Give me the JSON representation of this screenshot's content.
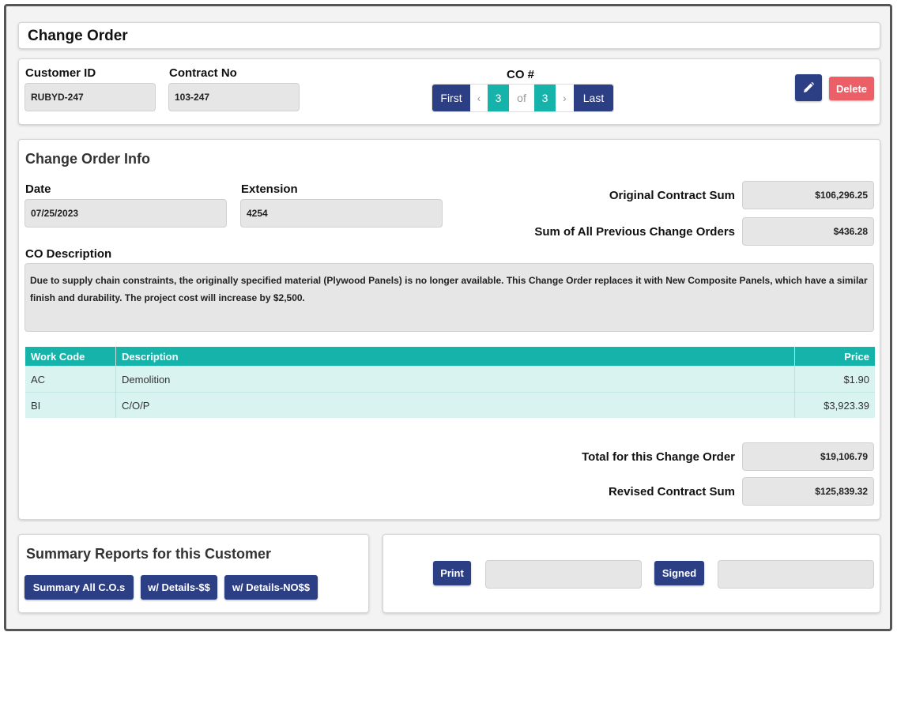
{
  "page": {
    "title": "Change Order"
  },
  "header": {
    "customer_id_label": "Customer ID",
    "customer_id_value": "RUBYD-247",
    "contract_no_label": "Contract No",
    "contract_no_value": "103-247",
    "co_label": "CO #",
    "pager": {
      "first": "First",
      "prev": "‹",
      "current": "3",
      "of": "of",
      "total": "3",
      "next": "›",
      "last": "Last"
    },
    "edit_icon": "pencil-icon",
    "delete_label": "Delete"
  },
  "info": {
    "section_title": "Change Order Info",
    "date_label": "Date",
    "date_value": "07/25/2023",
    "extension_label": "Extension",
    "extension_value": "4254",
    "original_sum_label": "Original Contract Sum",
    "original_sum_value": "$106,296.25",
    "previous_sum_label": "Sum of All Previous Change Orders",
    "previous_sum_value": "$436.28",
    "description_label": "CO Description",
    "description_value": "Due to supply chain constraints, the originally specified material (Plywood Panels) is no longer available. This Change Order replaces it with New Composite Panels, which have a similar finish and durability. The project cost will increase by $2,500."
  },
  "work_table": {
    "headers": {
      "code": "Work Code",
      "description": "Description",
      "price": "Price"
    },
    "rows": [
      {
        "code": "AC",
        "description": "Demolition",
        "price": "$1.90"
      },
      {
        "code": "BI",
        "description": "C/O/P",
        "price": "$3,923.39"
      }
    ]
  },
  "totals": {
    "total_label": "Total for this Change Order",
    "total_value": "$19,106.79",
    "revised_label": "Revised Contract Sum",
    "revised_value": "$125,839.32"
  },
  "summary": {
    "title": "Summary Reports for this Customer",
    "btn_all": "Summary All C.O.s",
    "btn_details": "w/ Details-$$",
    "btn_no_details": "w/ Details-NO$$"
  },
  "print_panel": {
    "print_label": "Print",
    "print_value": "",
    "signed_label": "Signed",
    "signed_value": ""
  },
  "colors": {
    "primary": "#2c3e84",
    "teal": "#16b3ab",
    "danger": "#ec5f67",
    "row_bg": "#d8f3f0"
  }
}
